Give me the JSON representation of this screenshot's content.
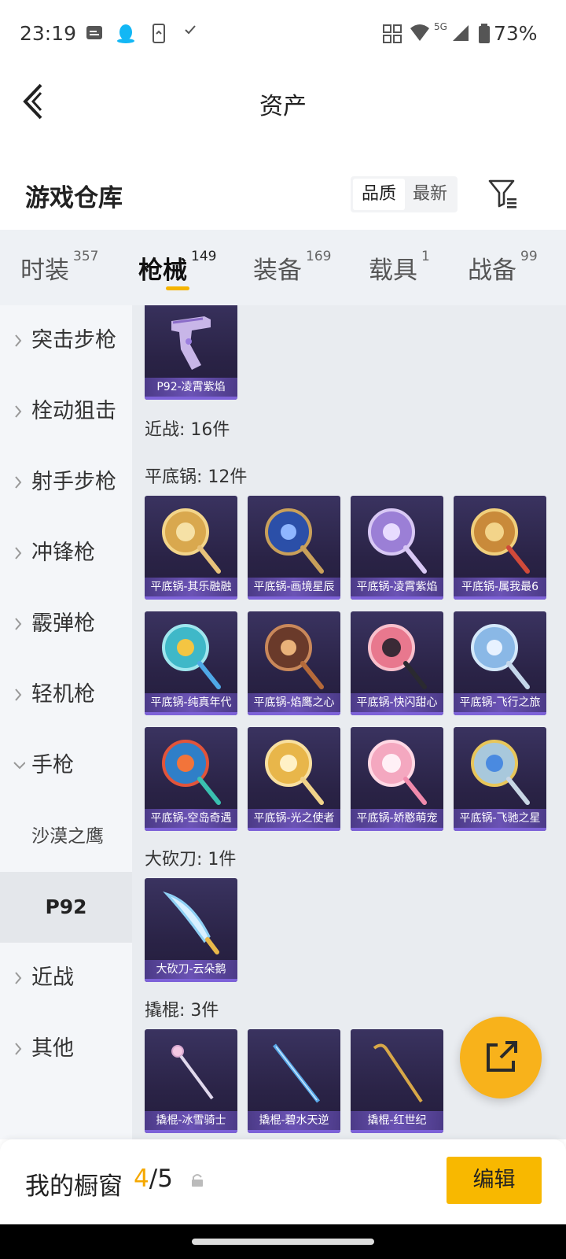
{
  "status_bar": {
    "time": "23:19",
    "network": "5G",
    "battery": "73%"
  },
  "nav": {
    "title": "资产"
  },
  "warehouse": {
    "title": "游戏仓库",
    "sort_options": [
      "品质",
      "最新"
    ],
    "active_sort": "品质"
  },
  "tabs": [
    {
      "label": "时装",
      "count": "357"
    },
    {
      "label": "枪械",
      "count": "149",
      "active": true
    },
    {
      "label": "装备",
      "count": "169"
    },
    {
      "label": "载具",
      "count": "1"
    },
    {
      "label": "战备",
      "count": "99"
    }
  ],
  "sidebar": {
    "categories": [
      "突击步枪",
      "栓动狙击",
      "射手步枪",
      "冲锋枪",
      "霰弹枪",
      "轻机枪",
      "手枪"
    ],
    "expanded": "手枪",
    "subcategories": [
      "沙漠之鹰",
      "P92"
    ],
    "selected_sub": "P92",
    "after": [
      "近战",
      "其他"
    ]
  },
  "content": {
    "p92_item": "P92-凌霄紫焰",
    "melee_header": "近战: 16件",
    "pan_header": "平底锅: 12件",
    "pans": [
      "平底锅-其乐融融",
      "平底锅-画境星辰",
      "平底锅-凌霄紫焰",
      "平底锅-属我最6",
      "平底锅-纯真年代",
      "平底锅-焰鹰之心",
      "平底锅-快闪甜心",
      "平底锅-飞行之旅",
      "平底锅-空岛奇遇",
      "平底锅-光之使者",
      "平底锅-娇憨萌宠",
      "平底锅-飞驰之星"
    ],
    "machete_header": "大砍刀: 1件",
    "machete_item": "大砍刀-云朵鹅",
    "crowbar_header": "撬棍: 3件",
    "crowbars": [
      "撬棍-冰雪骑士",
      "撬棍-碧水天逆",
      "撬棍-红世纪"
    ]
  },
  "bottom": {
    "label": "我的橱窗",
    "current": "4",
    "separator": "/",
    "total": "5",
    "edit": "编辑"
  },
  "colors": {
    "accent": "#f8b800",
    "rarity_purple": "#7d62d8"
  }
}
